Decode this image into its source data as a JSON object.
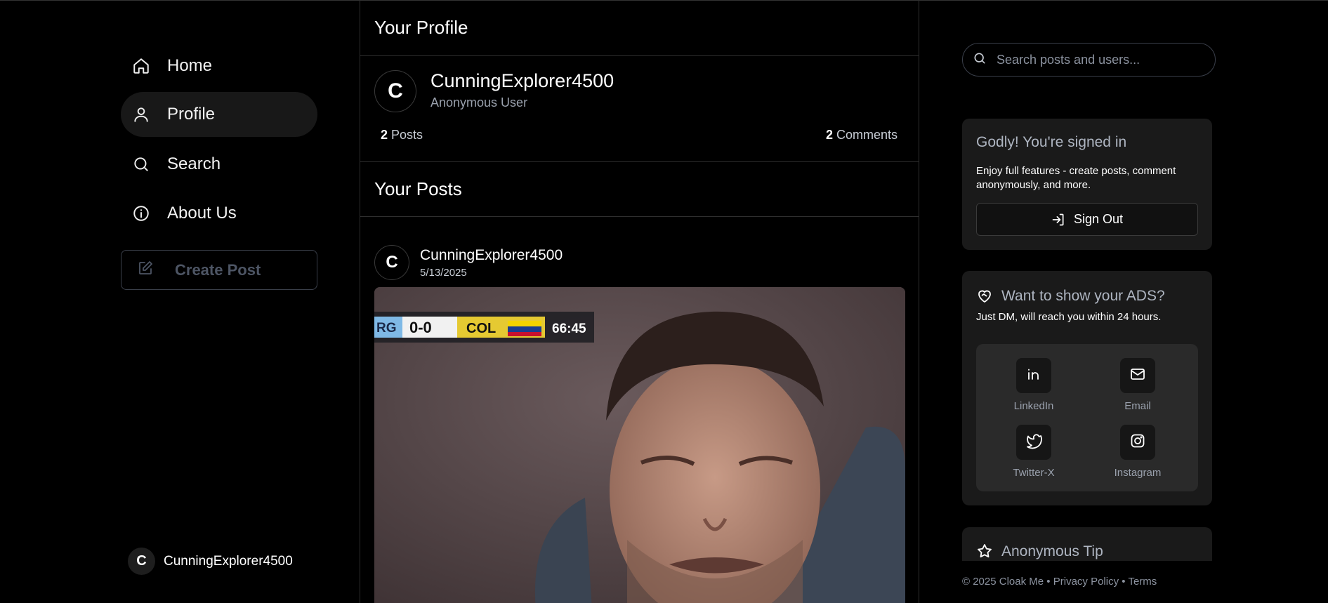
{
  "nav": {
    "items": [
      {
        "label": "Home",
        "icon": "home-icon"
      },
      {
        "label": "Profile",
        "icon": "user-icon"
      },
      {
        "label": "Search",
        "icon": "search-icon"
      },
      {
        "label": "About Us",
        "icon": "info-icon"
      }
    ],
    "active": "Profile",
    "create_label": "Create Post",
    "user": {
      "initial": "C",
      "name": "CunningExplorer4500"
    }
  },
  "profile": {
    "header": "Your Profile",
    "initial": "C",
    "username": "CunningExplorer4500",
    "subtitle": "Anonymous User",
    "posts_count": "2",
    "posts_label": "Posts",
    "comments_count": "2",
    "comments_label": "Comments"
  },
  "posts": {
    "header": "Your Posts",
    "items": [
      {
        "initial": "C",
        "author": "CunningExplorer4500",
        "date": "5/13/2025",
        "image_scoreboard": {
          "left": "RG",
          "score": "0-0",
          "right": "COL",
          "clock": "66:45"
        }
      }
    ]
  },
  "sidebar": {
    "search_placeholder": "Search posts and users...",
    "signin_card": {
      "title": "Godly! You're signed in",
      "desc": "Enjoy full features - create posts, comment anonymously, and more.",
      "button": "Sign Out"
    },
    "ads_card": {
      "title": "Want to show your ADS?",
      "desc": "Just DM, will reach you within 24 hours.",
      "links": [
        {
          "label": "LinkedIn",
          "icon": "linkedin-icon"
        },
        {
          "label": "Email",
          "icon": "mail-icon"
        },
        {
          "label": "Twitter-X",
          "icon": "twitter-icon"
        },
        {
          "label": "Instagram",
          "icon": "instagram-icon"
        }
      ]
    },
    "tip_card": {
      "title": "Anonymous Tip"
    },
    "footer": {
      "copyright": "© 2025 Cloak Me",
      "sep": "•",
      "privacy": "Privacy Policy",
      "terms": "Terms"
    }
  },
  "colors": {
    "background": "#000000",
    "card": "#1a1a1a",
    "border": "#2f2f2f",
    "muted_text": "#9aa1ad"
  }
}
